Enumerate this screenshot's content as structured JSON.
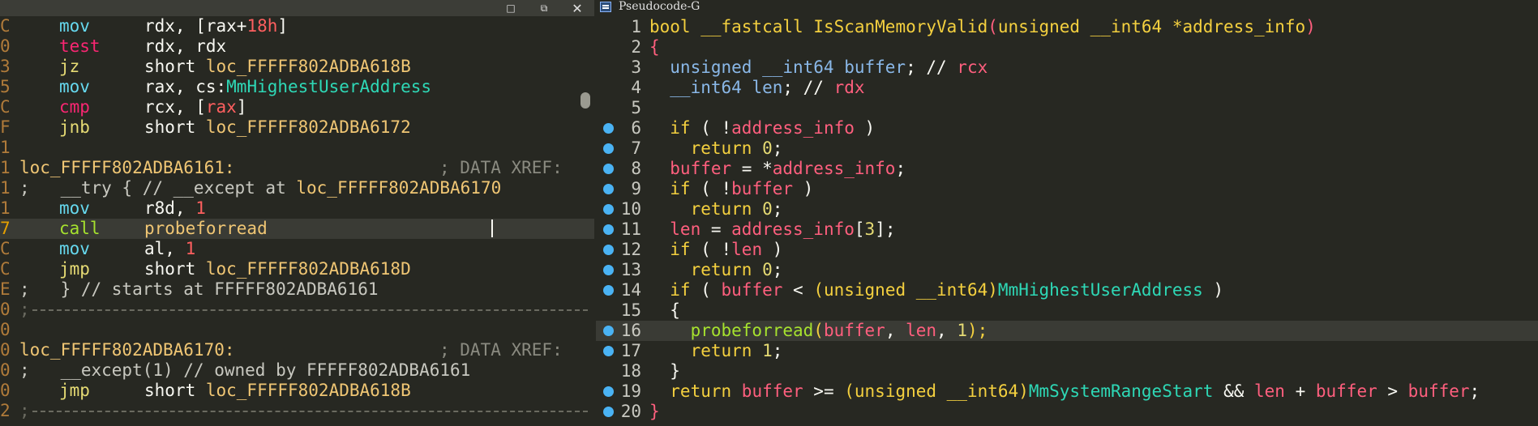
{
  "left": {
    "window_buttons": [
      "□",
      "⧉",
      "✕"
    ],
    "lines": [
      {
        "g": "C",
        "m": "mov",
        "o": [
          [
            "rdx, [",
            "c-white"
          ],
          [
            "rax",
            "c-white"
          ],
          [
            "+",
            "c-white"
          ],
          [
            "18h",
            "c-red"
          ],
          [
            "]",
            "c-white"
          ]
        ]
      },
      {
        "g": "0",
        "m": "test",
        "o": [
          [
            "rdx, rdx",
            "c-white"
          ]
        ]
      },
      {
        "g": "3",
        "m": "jz",
        "o": [
          [
            "short ",
            "c-white"
          ],
          [
            "loc_FFFFF802ADBA618B",
            "c-label"
          ]
        ]
      },
      {
        "g": "5",
        "m": "mov",
        "o": [
          [
            "rax, cs:",
            "c-white"
          ],
          [
            "MmHighestUserAddress",
            "c-teal"
          ]
        ]
      },
      {
        "g": "C",
        "m": "cmp",
        "o": [
          [
            "rcx, [",
            "c-white"
          ],
          [
            "rax",
            "c-red"
          ],
          [
            "]",
            "c-white"
          ]
        ]
      },
      {
        "g": "F",
        "m": "jnb",
        "o": [
          [
            "short ",
            "c-white"
          ],
          [
            "loc_FFFFF802ADBA6172",
            "c-label"
          ]
        ]
      },
      {
        "g": "1",
        "blank": true
      },
      {
        "g": "1",
        "label": "loc_FFFFF802ADBA6161:",
        "xref": "; DATA XREF:"
      },
      {
        "g": "1",
        "comment": [
          [
            ";   __try { // __except at ",
            "c-dim"
          ],
          [
            "loc_FFFFF802ADBA6170",
            "c-label"
          ]
        ]
      },
      {
        "g": "1",
        "m": "mov",
        "o": [
          [
            "r8d, ",
            "c-white"
          ],
          [
            "1",
            "c-red"
          ]
        ]
      },
      {
        "g": "7",
        "m": "call",
        "o": [
          [
            "probeforread",
            "c-label"
          ]
        ],
        "current": true
      },
      {
        "g": "C",
        "m": "mov",
        "o": [
          [
            "al, ",
            "c-white"
          ],
          [
            "1",
            "c-red"
          ]
        ]
      },
      {
        "g": "C",
        "m": "jmp",
        "o": [
          [
            "short ",
            "c-white"
          ],
          [
            "loc_FFFFF802ADBA618D",
            "c-label"
          ]
        ]
      },
      {
        "g": "E",
        "comment": [
          [
            ";   } // starts at FFFFF802ADBA6161",
            "c-dim"
          ]
        ]
      },
      {
        "g": "0",
        "sep": true
      },
      {
        "g": "0",
        "blank": true
      },
      {
        "g": "0",
        "label": "loc_FFFFF802ADBA6170:",
        "xref": "; DATA XREF:"
      },
      {
        "g": "0",
        "comment": [
          [
            ";   __except(1) // owned by FFFFF802ADBA6161",
            "c-dim"
          ]
        ]
      },
      {
        "g": "0",
        "m": "jmp",
        "o": [
          [
            "short ",
            "c-white"
          ],
          [
            "loc_FFFFF802ADBA618B",
            "c-label"
          ]
        ]
      },
      {
        "g": "2",
        "sep": true
      }
    ],
    "mnemonic_colors": {
      "mov": "m-blue",
      "test": "m-pink",
      "jz": "m-yellow",
      "cmp": "m-pink",
      "jnb": "m-yellow",
      "call": "m-green",
      "jmp": "m-yellow"
    }
  },
  "right": {
    "tab_title": "Pseudocode-G",
    "lines": [
      {
        "n": "1",
        "bp": false,
        "tokens": [
          [
            "bool ",
            "k-yellow"
          ],
          [
            "__fastcall ",
            "k-yellow"
          ],
          [
            "IsScanMemoryValid",
            "k-yellow"
          ],
          [
            "(",
            "k-red"
          ],
          [
            "unsigned __int64 *",
            "k-yellow"
          ],
          [
            "address_info",
            "k-yellow"
          ],
          [
            ")",
            "k-red"
          ]
        ]
      },
      {
        "n": "2",
        "bp": false,
        "tokens": [
          [
            "{",
            "k-red"
          ]
        ]
      },
      {
        "n": "3",
        "bp": false,
        "tokens": [
          [
            "  unsigned __int64 ",
            "k-blue"
          ],
          [
            "buffer",
            "k-blue"
          ],
          [
            "; // ",
            "k-white"
          ],
          [
            "rcx",
            "k-red"
          ]
        ]
      },
      {
        "n": "4",
        "bp": false,
        "tokens": [
          [
            "  __int64 ",
            "k-blue"
          ],
          [
            "len",
            "k-blue"
          ],
          [
            "; // ",
            "k-white"
          ],
          [
            "rdx",
            "k-red"
          ]
        ]
      },
      {
        "n": "5",
        "bp": false,
        "tokens": []
      },
      {
        "n": "6",
        "bp": true,
        "tokens": [
          [
            "  if",
            "k-yellow"
          ],
          [
            " ( !",
            "k-white"
          ],
          [
            "address_info",
            "k-red"
          ],
          [
            " )",
            "k-white"
          ]
        ]
      },
      {
        "n": "7",
        "bp": true,
        "tokens": [
          [
            "    return ",
            "k-yellow"
          ],
          [
            "0",
            "k-num"
          ],
          [
            ";",
            "k-white"
          ]
        ]
      },
      {
        "n": "8",
        "bp": true,
        "tokens": [
          [
            "  buffer",
            "k-red"
          ],
          [
            " = *",
            "k-white"
          ],
          [
            "address_info",
            "k-red"
          ],
          [
            ";",
            "k-white"
          ]
        ]
      },
      {
        "n": "9",
        "bp": true,
        "tokens": [
          [
            "  if",
            "k-yellow"
          ],
          [
            " ( !",
            "k-white"
          ],
          [
            "buffer",
            "k-red"
          ],
          [
            " )",
            "k-white"
          ]
        ]
      },
      {
        "n": "10",
        "bp": true,
        "tokens": [
          [
            "    return ",
            "k-yellow"
          ],
          [
            "0",
            "k-num"
          ],
          [
            ";",
            "k-white"
          ]
        ]
      },
      {
        "n": "11",
        "bp": true,
        "tokens": [
          [
            "  len",
            "k-red"
          ],
          [
            " = ",
            "k-white"
          ],
          [
            "address_info",
            "k-red"
          ],
          [
            "[",
            "k-white"
          ],
          [
            "3",
            "k-num"
          ],
          [
            "];",
            "k-white"
          ]
        ]
      },
      {
        "n": "12",
        "bp": true,
        "tokens": [
          [
            "  if",
            "k-yellow"
          ],
          [
            " ( !",
            "k-white"
          ],
          [
            "len",
            "k-red"
          ],
          [
            " )",
            "k-white"
          ]
        ]
      },
      {
        "n": "13",
        "bp": true,
        "tokens": [
          [
            "    return ",
            "k-yellow"
          ],
          [
            "0",
            "k-num"
          ],
          [
            ";",
            "k-white"
          ]
        ]
      },
      {
        "n": "14",
        "bp": true,
        "tokens": [
          [
            "  if",
            "k-yellow"
          ],
          [
            " ( ",
            "k-white"
          ],
          [
            "buffer",
            "k-red"
          ],
          [
            " < ",
            "k-white"
          ],
          [
            "(",
            "k-yellow"
          ],
          [
            "unsigned __int64",
            "k-yellow"
          ],
          [
            ")",
            "k-yellow"
          ],
          [
            "MmHighestUserAddress",
            "k-cyan"
          ],
          [
            " )",
            "k-white"
          ]
        ]
      },
      {
        "n": "15",
        "bp": false,
        "tokens": [
          [
            "  {",
            "k-white"
          ]
        ]
      },
      {
        "n": "16",
        "bp": true,
        "current": true,
        "tokens": [
          [
            "    probeforread",
            "k-green"
          ],
          [
            "(",
            "k-yellow"
          ],
          [
            "buffer",
            "k-red"
          ],
          [
            ", ",
            "k-white"
          ],
          [
            "len",
            "k-red"
          ],
          [
            ", ",
            "k-white"
          ],
          [
            "1",
            "k-num"
          ],
          [
            ");",
            "k-yellow"
          ]
        ]
      },
      {
        "n": "17",
        "bp": true,
        "tokens": [
          [
            "    return ",
            "k-yellow"
          ],
          [
            "1",
            "k-num"
          ],
          [
            ";",
            "k-white"
          ]
        ]
      },
      {
        "n": "18",
        "bp": false,
        "tokens": [
          [
            "  }",
            "k-white"
          ]
        ]
      },
      {
        "n": "19",
        "bp": true,
        "tokens": [
          [
            "  return ",
            "k-yellow"
          ],
          [
            "buffer",
            "k-red"
          ],
          [
            " >= ",
            "k-white"
          ],
          [
            "(",
            "k-yellow"
          ],
          [
            "unsigned __int64",
            "k-yellow"
          ],
          [
            ")",
            "k-yellow"
          ],
          [
            "MmSystemRangeStart",
            "k-cyan"
          ],
          [
            " && ",
            "k-white"
          ],
          [
            "len",
            "k-red"
          ],
          [
            " + ",
            "k-white"
          ],
          [
            "buffer",
            "k-red"
          ],
          [
            " > ",
            "k-white"
          ],
          [
            "buffer",
            "k-red"
          ],
          [
            ";",
            "k-white"
          ]
        ]
      },
      {
        "n": "20",
        "bp": true,
        "tokens": [
          [
            "}",
            "k-red"
          ]
        ]
      }
    ]
  }
}
